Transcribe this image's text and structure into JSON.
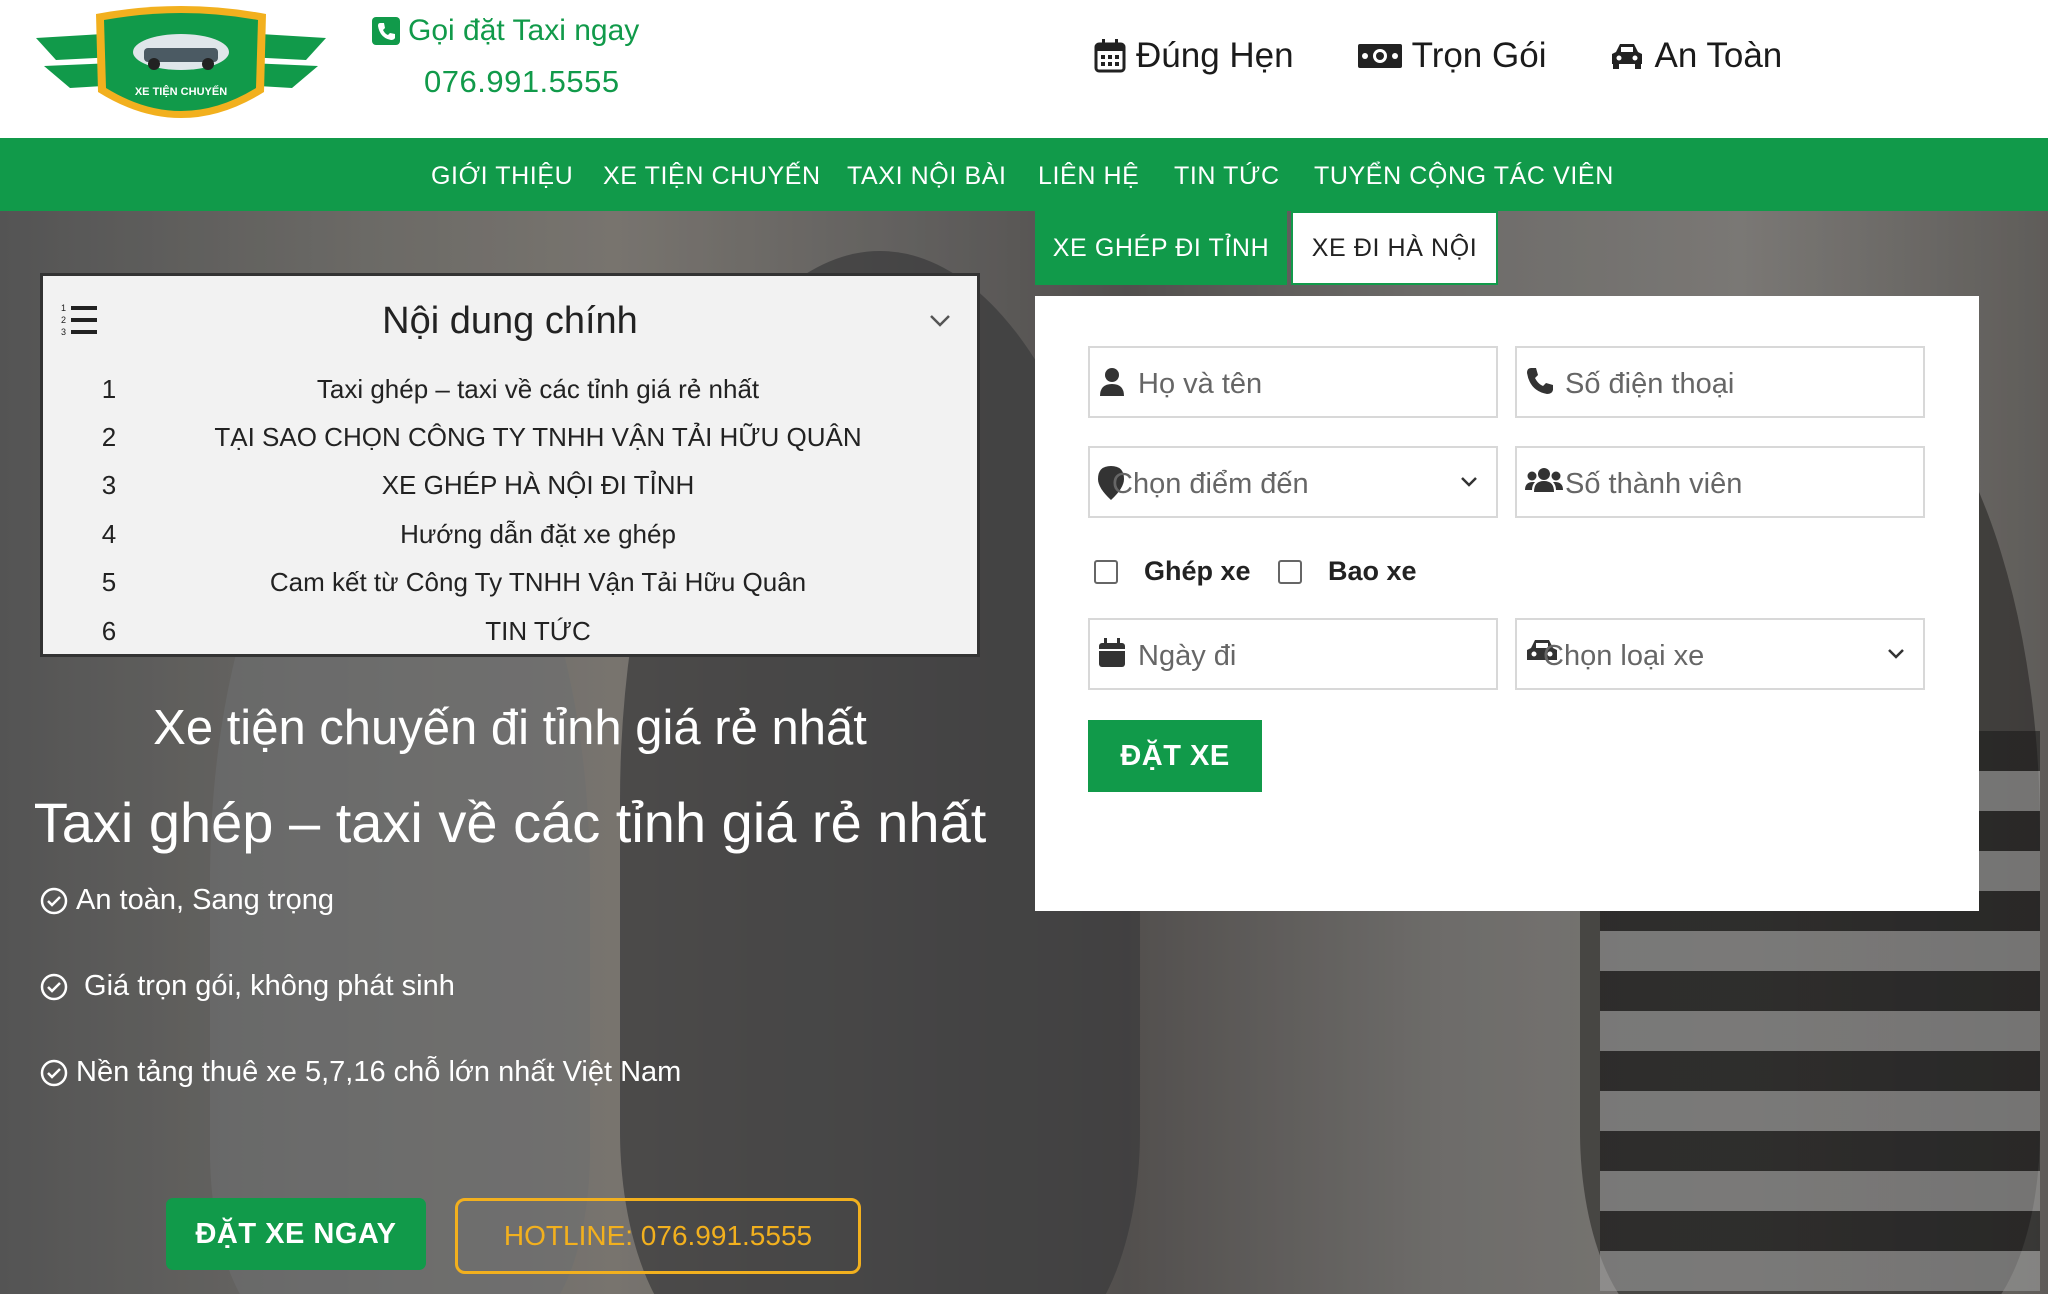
{
  "header": {
    "logo_text": "XE TIỆN CHUYẾN",
    "call_label": "Gọi đặt Taxi ngay",
    "call_number": "076.991.5555",
    "features": [
      {
        "label": "Đúng Hẹn",
        "icon": "calendar-icon"
      },
      {
        "label": "Trọn Gói",
        "icon": "money-icon"
      },
      {
        "label": "An Toàn",
        "icon": "car-icon"
      }
    ],
    "brand_color": "#119a4a"
  },
  "nav": {
    "items": [
      "GIỚI THIỆU",
      "XE TIỆN CHUYẾN",
      "TAXI NỘI BÀI",
      "LIÊN HỆ",
      "TIN TỨC",
      "TUYỂN CỘNG TÁC VIÊN"
    ]
  },
  "toc": {
    "title": "Nội dung chính",
    "items": [
      {
        "num": "1",
        "text": "Taxi ghép – taxi về các tỉnh giá rẻ nhất"
      },
      {
        "num": "2",
        "text": "TẠI SAO CHỌN CÔNG TY TNHH VẬN TẢI HỮU QUÂN"
      },
      {
        "num": "3",
        "text": "XE GHÉP HÀ NỘI ĐI TỈNH"
      },
      {
        "num": "4",
        "text": "Hướng dẫn đặt xe ghép"
      },
      {
        "num": "5",
        "text": "Cam kết từ Công Ty TNHH Vận Tải Hữu Quân"
      },
      {
        "num": "6",
        "text": "TIN TỨC"
      }
    ]
  },
  "hero": {
    "headline": "Xe tiện chuyến đi tỉnh giá rẻ nhất",
    "subheadline": "Taxi ghép – taxi về các tỉnh giá rẻ nhất",
    "bullets": [
      "An toàn, Sang trọng",
      " Giá trọn gói, không phát sinh",
      "Nền tảng thuê xe 5,7,16 chỗ lớn nhất Việt Nam"
    ],
    "book_button": "ĐẶT XE NGAY",
    "hotline_button": "HOTLINE: 076.991.5555",
    "hotline_color": "#f2b01e"
  },
  "booking": {
    "tabs": [
      "XE GHÉP ĐI TỈNH",
      "XE ĐI HÀ NỘI"
    ],
    "name_placeholder": "Họ và tên",
    "phone_placeholder": "Số điện thoại",
    "destination_select": "Chọn điểm đến",
    "members_placeholder": "Số thành viên",
    "option_share": "Ghép xe",
    "option_private": "Bao xe",
    "date_placeholder": "Ngày đi",
    "car_type_select": "Chọn loại xe",
    "submit": "ĐẶT XE"
  }
}
